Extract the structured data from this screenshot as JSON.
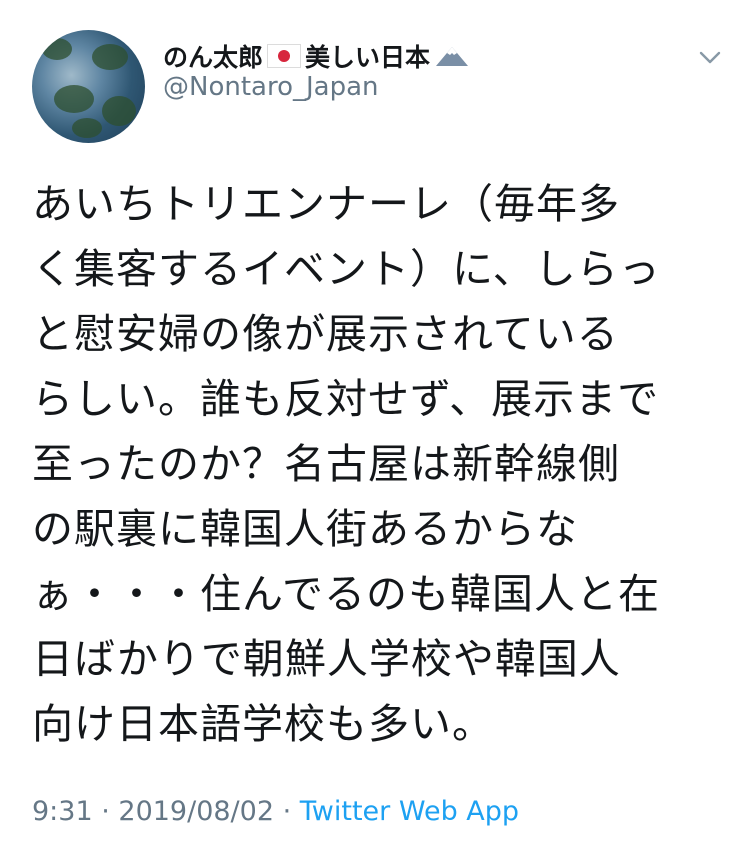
{
  "user": {
    "display_name": "のん太郎",
    "display_name_suffix": "美しい日本",
    "handle": "@Nontaro_Japan",
    "flag_icon": "japan-flag-icon",
    "mountain_icon": "mountain-icon"
  },
  "tweet": {
    "lines": [
      "あいちトリエンナーレ（毎年多",
      "く集客するイベント）に、しらっ",
      "と慰安婦の像が展示されている",
      "らしい。誰も反対せず、展示まで",
      "至ったのか？名古屋は新幹線側",
      "の駅裏に韓国人街あるからな",
      "ぁ・・・住んでるのも韓国人と在",
      "日ばかりで朝鮮人学校や韓国人",
      "向け日本語学校も多い。"
    ]
  },
  "meta": {
    "time": "9:31",
    "separator": " · ",
    "date": "2019/08/02",
    "separator2": " · ",
    "app": "Twitter Web App"
  },
  "colors": {
    "text": "#14171a",
    "secondary": "#657786",
    "link": "#1da1f2"
  },
  "icons": {
    "menu": "chevron-down-icon"
  }
}
